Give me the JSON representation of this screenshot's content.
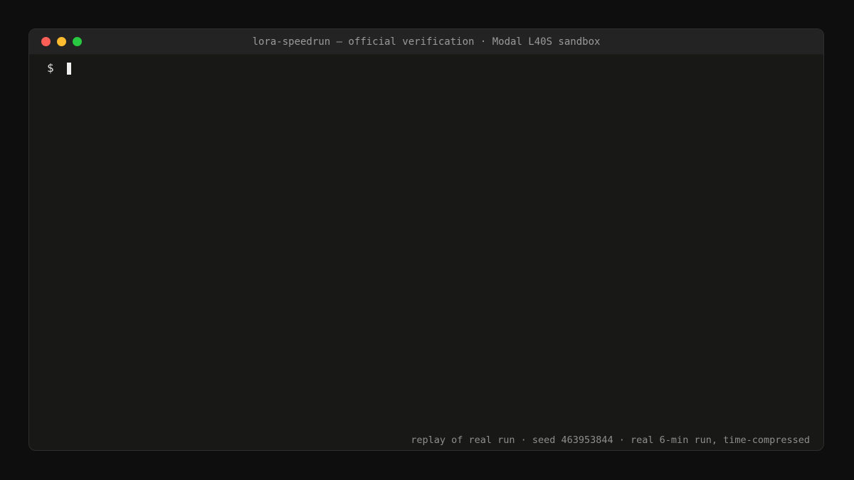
{
  "window": {
    "title": "lora-speedrun — official verification · Modal L40S sandbox",
    "controls": [
      {
        "name": "close",
        "color": "#ff5f57"
      },
      {
        "name": "minimize",
        "color": "#febc2e"
      },
      {
        "name": "maximize",
        "color": "#28c840"
      }
    ]
  },
  "terminal": {
    "prompt": "$",
    "input_value": "",
    "footer": "replay of real run · seed 463953844 · real 6-min run, time-compressed"
  },
  "colors": {
    "page_background": "#0e0e0e",
    "terminal_background": "#181817",
    "titlebar_background": "#232323",
    "text": "#e0e0e0",
    "muted_text": "#8e8e8e"
  }
}
